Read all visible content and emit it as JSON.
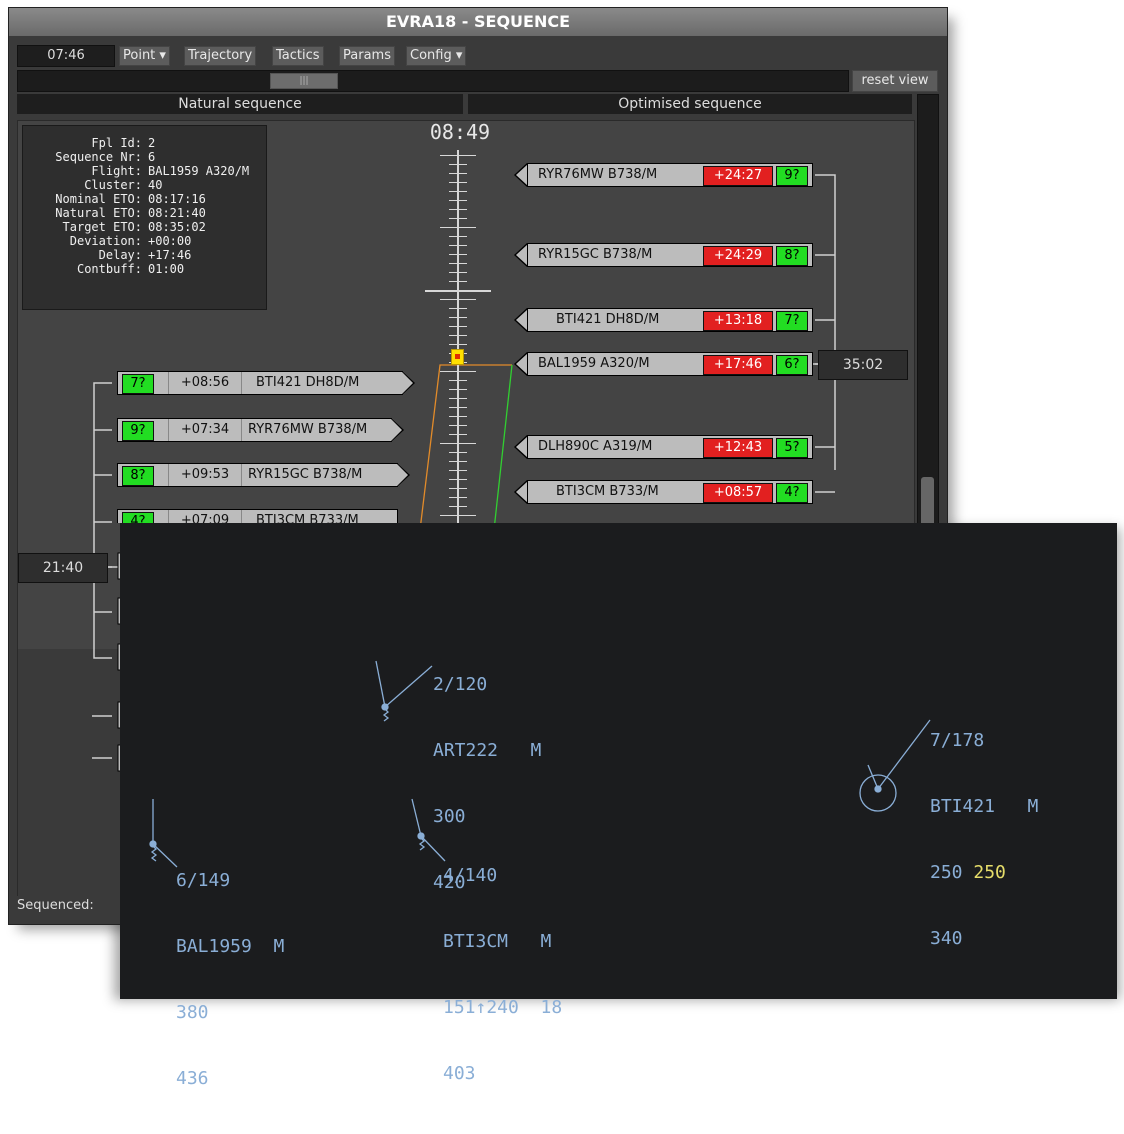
{
  "window": {
    "title": "EVRA18 - SEQUENCE",
    "clock": "07:46",
    "menus": [
      "Point",
      "Trajectory",
      "Tactics",
      "Params",
      "Config"
    ],
    "reset_view": "reset view",
    "col_natural": "Natural sequence",
    "col_optimised": "Optimised sequence",
    "status": "Sequenced:"
  },
  "info": {
    "rows": [
      {
        "k": "Fpl Id:",
        "v": "2"
      },
      {
        "k": "Sequence Nr:",
        "v": "6"
      },
      {
        "k": "Flight:",
        "v": "BAL1959 A320/M"
      },
      {
        "k": "Cluster:",
        "v": "40"
      },
      {
        "k": "Nominal ETO:",
        "v": "08:17:16"
      },
      {
        "k": "Natural ETO:",
        "v": "08:21:40"
      },
      {
        "k": "Target ETO:",
        "v": "08:35:02"
      },
      {
        "k": "Deviation:",
        "v": "+00:00"
      },
      {
        "k": "Delay:",
        "v": "+17:46"
      },
      {
        "k": "Contbuff:",
        "v": "01:00"
      }
    ]
  },
  "timeline": {
    "time": "08:49"
  },
  "optimised": [
    {
      "callsign": "RYR76MW B738/M",
      "delay": "+24:27",
      "seq": "9?"
    },
    {
      "callsign": "RYR15GC B738/M",
      "delay": "+24:29",
      "seq": "8?"
    },
    {
      "callsign": "BTI421 DH8D/M",
      "delay": "+13:18",
      "seq": "7?"
    },
    {
      "callsign": "BAL1959 A320/M",
      "delay": "+17:46",
      "seq": "6?"
    },
    {
      "callsign": "DLH890C A319/M",
      "delay": "+12:43",
      "seq": "5?"
    },
    {
      "callsign": "BTI3CM B733/M",
      "delay": "+08:57",
      "seq": "4?"
    }
  ],
  "natural": [
    {
      "seq": "7?",
      "delay": "+08:56",
      "callsign": "BTI421 DH8D/M"
    },
    {
      "seq": "9?",
      "delay": "+07:34",
      "callsign": "RYR76MW B738/M"
    },
    {
      "seq": "8?",
      "delay": "+09:53",
      "callsign": "RYR15GC B738/M"
    },
    {
      "seq": "4?",
      "delay": "+07:09",
      "callsign": "BTI3CM B733/M"
    }
  ],
  "box_right": "35:02",
  "box_left": "21:40",
  "radar": {
    "aircraft": [
      {
        "lines": [
          "2/120",
          "ART222   M",
          "300",
          "420"
        ]
      },
      {
        "lines": [
          "7/178",
          "BTI421   M",
          "250 ",
          "340"
        ],
        "cleared": "250"
      },
      {
        "lines": [
          "6/149",
          "BAL1959  M",
          "380",
          "436"
        ]
      },
      {
        "lines": [
          "4/140",
          "BTI3CM   M",
          "151↑240  18",
          "403"
        ]
      }
    ]
  },
  "colors": {
    "panel_bg": "#444444",
    "radar_bg": "#1b1c1e",
    "radar_text": "#8aaed6",
    "cleared_level": "#e6dd6a",
    "delay_red": "#e22020",
    "seq_green": "#22dd22"
  }
}
